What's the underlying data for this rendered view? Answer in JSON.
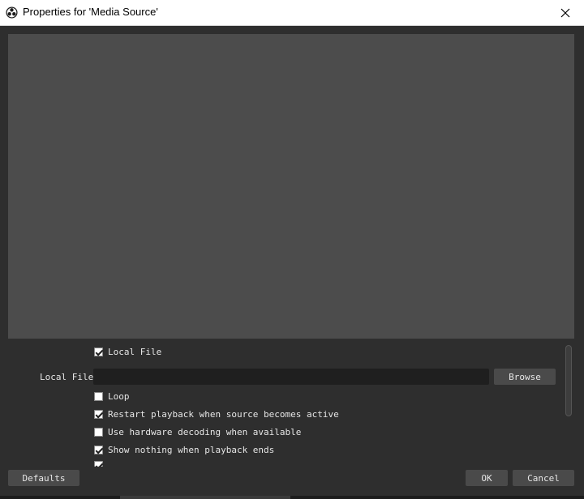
{
  "window": {
    "title": "Properties for 'Media Source'",
    "app_icon": "obs-logo-icon",
    "close_icon": "close-icon"
  },
  "colors": {
    "background": "#2e2e2e",
    "preview": "#4c4c4c",
    "input": "#1f1f1f",
    "button": "#4a4a4a",
    "text": "#e6e6e6"
  },
  "properties": {
    "local_file_checkbox": {
      "label": "Local File",
      "checked": true
    },
    "local_file_field": {
      "label": "Local File",
      "value": "",
      "browse_label": "Browse"
    },
    "loop": {
      "label": "Loop",
      "checked": false
    },
    "restart_playback": {
      "label": "Restart playback when source becomes active",
      "checked": true
    },
    "hardware_decoding": {
      "label": "Use hardware decoding when available",
      "checked": false
    },
    "show_nothing": {
      "label": "Show nothing when playback ends",
      "checked": true
    }
  },
  "footer": {
    "defaults_label": "Defaults",
    "ok_label": "OK",
    "cancel_label": "Cancel"
  }
}
